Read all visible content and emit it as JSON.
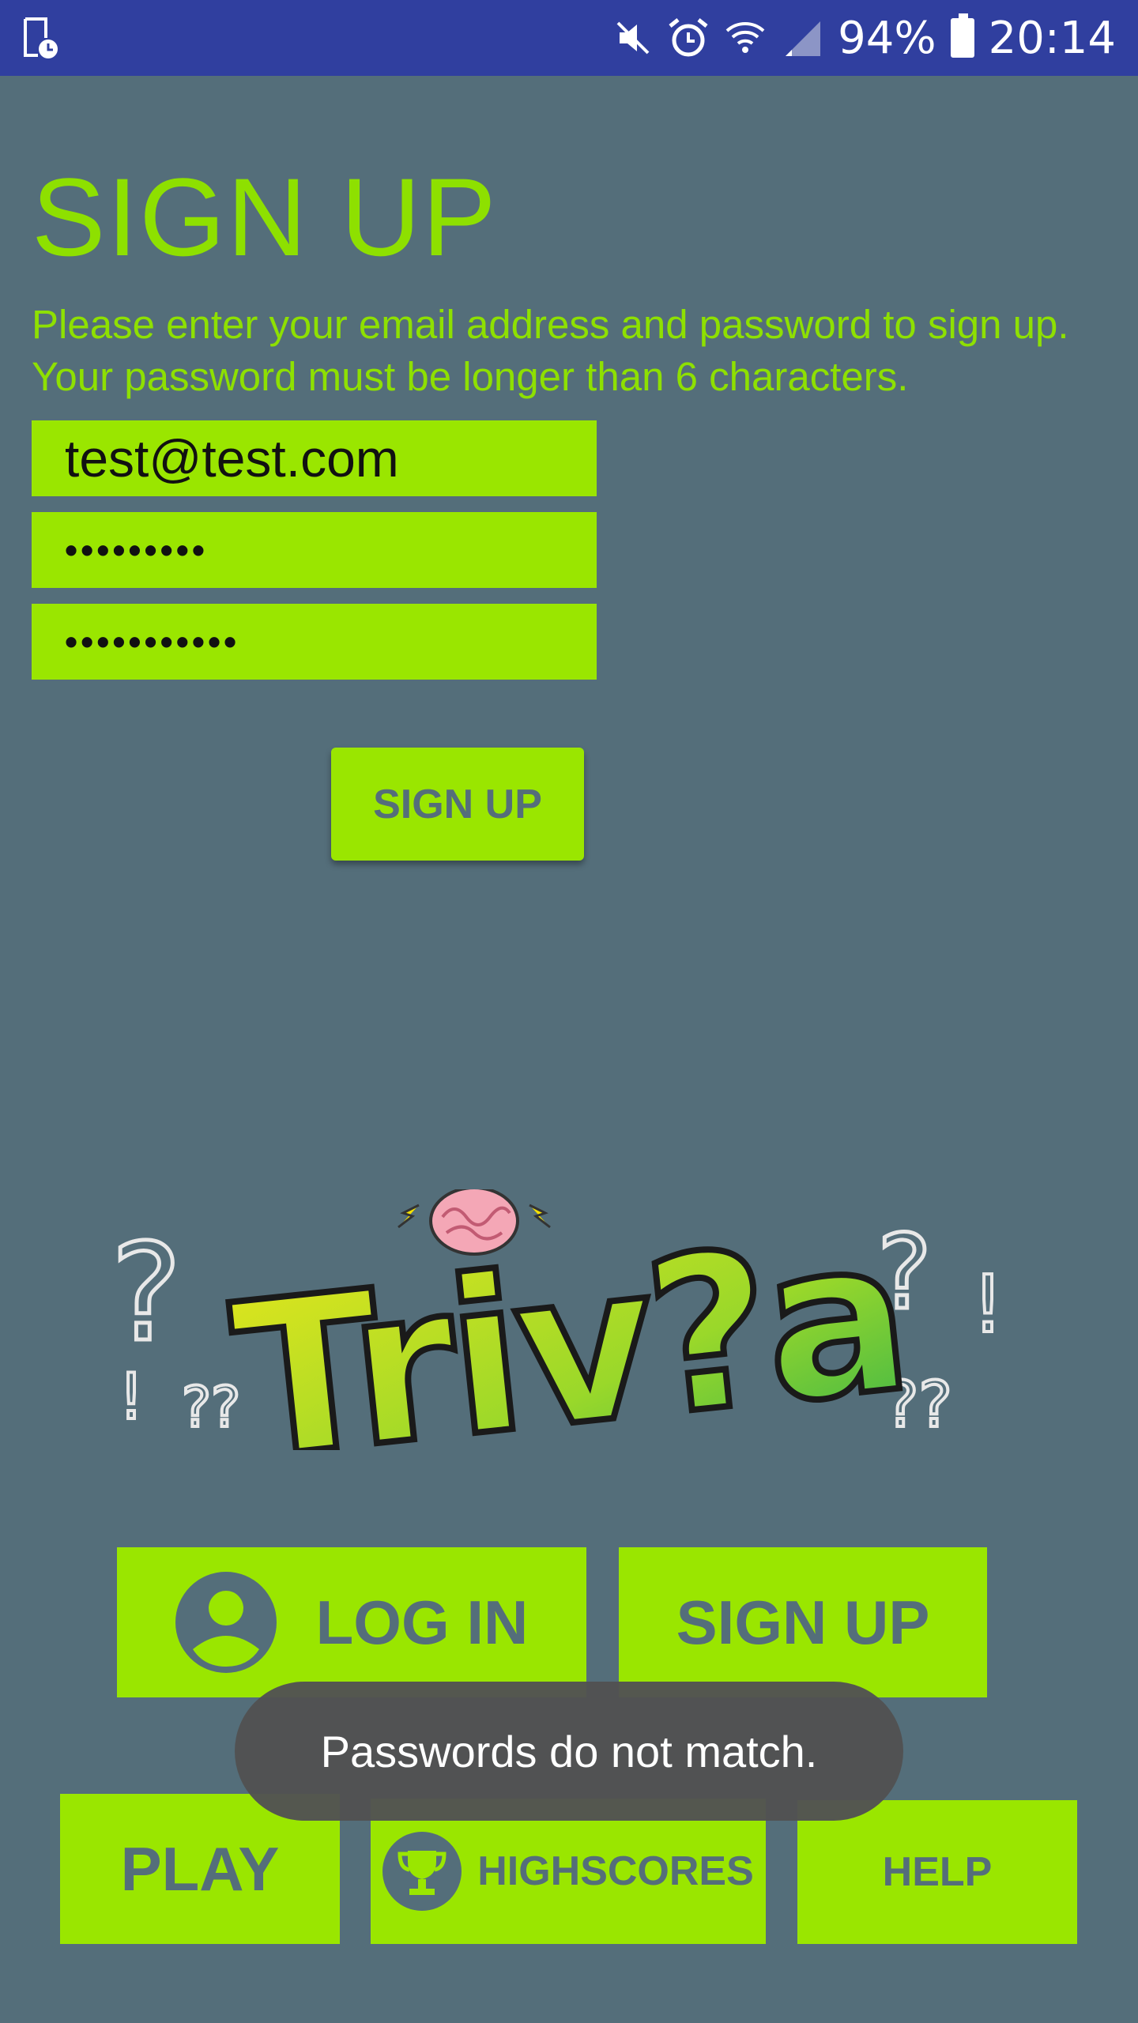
{
  "status_bar": {
    "battery": "94%",
    "time": "20:14",
    "icons": [
      "screenshot-icon",
      "mute-icon",
      "alarm-icon",
      "wifi-icon",
      "signal-icon",
      "battery-icon"
    ]
  },
  "page": {
    "title": "SIGN UP",
    "description": "Please enter your email address and password to sign up. Your password must be longer than 6 characters."
  },
  "form": {
    "email_value": "test@test.com",
    "password_value": "•••••••••",
    "confirm_password_value": "•••••••••••",
    "submit_label": "SIGN UP"
  },
  "logo": {
    "text": "Triv?a",
    "decor": "?!?!?"
  },
  "menu": {
    "login_label": "LOG IN",
    "signup_label": "SIGN UP",
    "play_label": "PLAY",
    "highscores_label": "HIGHSCORES",
    "help_label": "HELP"
  },
  "toast": {
    "message": "Passwords do not match."
  },
  "colors": {
    "background": "#546e7a",
    "status_bar": "#303f9f",
    "accent_green": "#9ae600",
    "title_green": "#8ee000",
    "toast_bg": "#525252"
  }
}
